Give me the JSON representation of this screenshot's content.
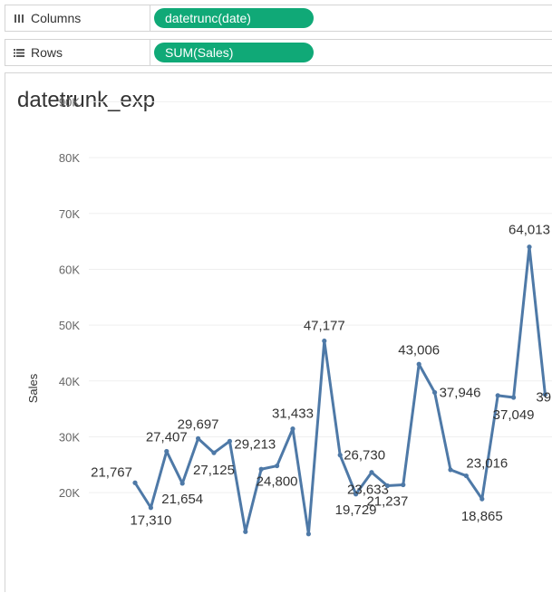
{
  "shelves": {
    "columns": {
      "label": "Columns",
      "icon": "columns-icon",
      "pill": "datetrunc(date)"
    },
    "rows": {
      "label": "Rows",
      "icon": "rows-icon",
      "pill": "SUM(Sales)"
    }
  },
  "colors": {
    "pill": "#10a977",
    "line": "#4e79a7"
  },
  "sheet_title": "datetrunk_exp",
  "chart_data": {
    "type": "line",
    "title": "datetrunk_exp",
    "ylabel": "Sales",
    "xlabel": "",
    "ylim": [
      13000,
      96000
    ],
    "ytick_values": [
      20000,
      30000,
      40000,
      50000,
      60000,
      70000,
      80000,
      90000
    ],
    "yticks": [
      "20K",
      "30K",
      "40K",
      "50K",
      "60K",
      "70K",
      "80K",
      "90K"
    ],
    "grid": true,
    "series": [
      {
        "values": [
          21767,
          17310,
          27407,
          21654,
          29697,
          27125,
          29213,
          13000,
          24200,
          24800,
          31433,
          12600,
          47177,
          26730,
          19729,
          23633,
          21237,
          21400,
          43006,
          37946,
          24100,
          23016,
          18865,
          37400,
          37049,
          64013,
          37600
        ],
        "labels": [
          "21,767",
          "17,310",
          "27,407",
          "21,654",
          "29,697",
          "27,125",
          "29,213",
          "",
          "",
          "24,800",
          "31,433",
          "",
          "47,177",
          "26,730",
          "19,729",
          "23,633",
          "21,237",
          "",
          "43,006",
          "37,946",
          "",
          "23,016",
          "18,865",
          "",
          "37,049",
          "64,013",
          "39"
        ]
      }
    ]
  }
}
